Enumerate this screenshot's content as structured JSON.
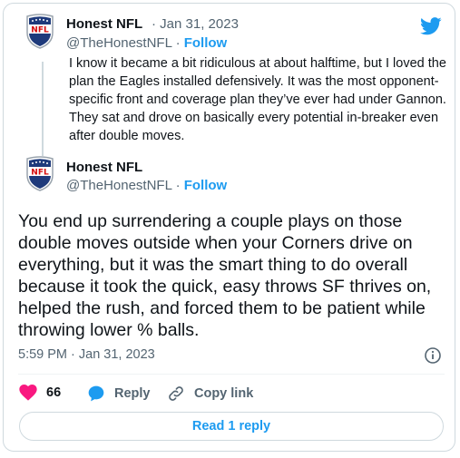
{
  "brand": {
    "accent": "#1d9bf0",
    "like_color": "#f91880",
    "text": "#0f1419",
    "muted": "#536471"
  },
  "quoted_tweet": {
    "display_name": "Honest NFL",
    "separator": "·",
    "date": "Jan 31, 2023",
    "handle": "@TheHonestNFL",
    "follow_label": "Follow",
    "text": "I know it became a bit ridiculous at about halftime, but I loved the plan the Eagles installed defensively. It was the most opponent-specific front and coverage plan they’ve ever had under Gannon. They sat and drove on basically every potential in-breaker even after double moves."
  },
  "main_tweet": {
    "display_name": "Honest NFL",
    "handle": "@TheHonestNFL",
    "separator": "·",
    "follow_label": "Follow",
    "text": "You end up surrendering a couple plays on those double moves outside when your Corners drive on everything, but it was the smart thing to do overall because it took the quick, easy throws SF thrives on, helped the rush, and forced them to be patient while throwing lower % balls.",
    "timestamp": "5:59 PM · Jan 31, 2023"
  },
  "actions": {
    "like_count": "66",
    "reply_label": "Reply",
    "copy_link_label": "Copy link"
  },
  "read_replies_label": "Read 1 reply",
  "icons": {
    "logo": "twitter-bird-icon",
    "avatar": "nfl-shield-icon",
    "info": "info-icon",
    "like": "heart-icon",
    "reply": "speech-bubble-icon",
    "copy": "link-icon"
  }
}
